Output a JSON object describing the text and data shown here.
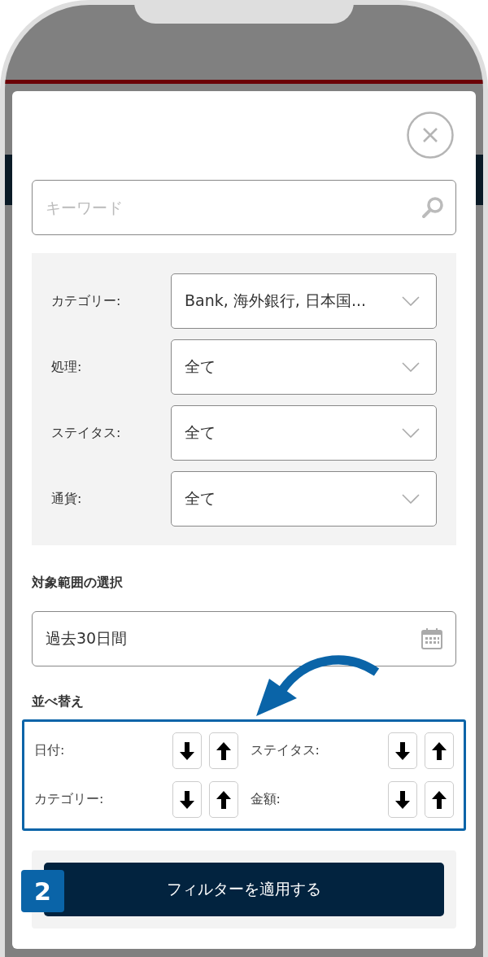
{
  "keyword": {
    "placeholder": "キーワード"
  },
  "filters": [
    {
      "label": "カテゴリー:",
      "value": "Bank, 海外銀行, 日本国..."
    },
    {
      "label": "処理:",
      "value": "全て"
    },
    {
      "label": "ステイタス:",
      "value": "全て"
    },
    {
      "label": "通貨:",
      "value": "全て"
    }
  ],
  "range": {
    "heading": "対象範囲の選択",
    "value": "過去30日間"
  },
  "sort": {
    "heading": "並べ替え",
    "fields": [
      {
        "label": "日付:"
      },
      {
        "label": "ステイタス:"
      },
      {
        "label": "カテゴリー:"
      },
      {
        "label": "金額:"
      }
    ]
  },
  "apply_button": "フィルターを適用する",
  "step_badge": "2"
}
